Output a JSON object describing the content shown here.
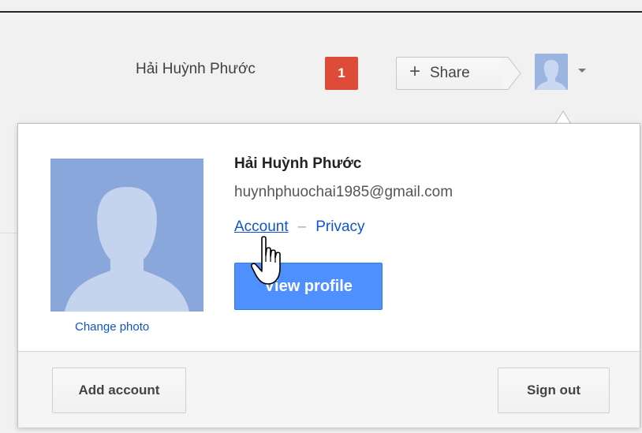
{
  "header": {
    "user_name": "Hải Huỳnh Phước",
    "notification_count": "1",
    "share_plus": "+",
    "share_label": "Share"
  },
  "profile_card": {
    "name": "Hải Huỳnh Phước",
    "email": "huynhphuochai1985@gmail.com",
    "account_link": "Account",
    "separator": "–",
    "privacy_link": "Privacy",
    "view_profile_label": "View profile",
    "change_photo_label": "Change photo"
  },
  "footer": {
    "add_account_label": "Add account",
    "sign_out_label": "Sign out"
  },
  "colors": {
    "notification_red": "#dd4b39",
    "button_blue": "#4d90fe",
    "link_blue": "#1155cc",
    "avatar_blue": "#8aa7dc"
  },
  "icons": [
    "avatar-silhouette-icon",
    "chevron-down-icon",
    "hand-pointer-icon"
  ]
}
